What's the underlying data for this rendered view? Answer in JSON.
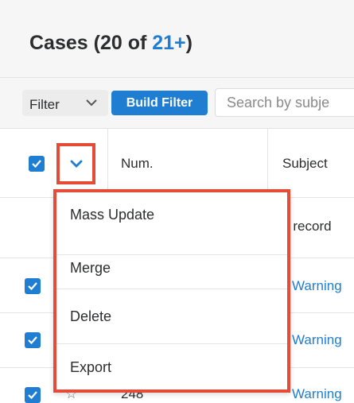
{
  "header": {
    "title_prefix": "Cases (20 of ",
    "count": "21+",
    "title_suffix": ")"
  },
  "filterbar": {
    "filter_label": "Filter",
    "build_filter_label": "Build Filter",
    "search_placeholder": "Search by subje"
  },
  "table": {
    "columns": [
      {
        "label": "Num."
      },
      {
        "label": "Subject"
      }
    ],
    "select_all_checked": true,
    "behind_menu": {
      "records_fragment": ") record"
    },
    "rows": [
      {
        "checked": true,
        "subject": "Warning"
      },
      {
        "checked": true,
        "subject": "Warning"
      },
      {
        "checked": true,
        "num": "248",
        "star": "☆",
        "subject": "Warning"
      }
    ]
  },
  "actions_menu": {
    "items": [
      {
        "label": "Mass Update"
      },
      {
        "label": "Merge"
      },
      {
        "label": "Delete"
      },
      {
        "label": "Export"
      }
    ]
  },
  "colors": {
    "accent": "#1f7ed1",
    "highlight": "#e44c37"
  }
}
